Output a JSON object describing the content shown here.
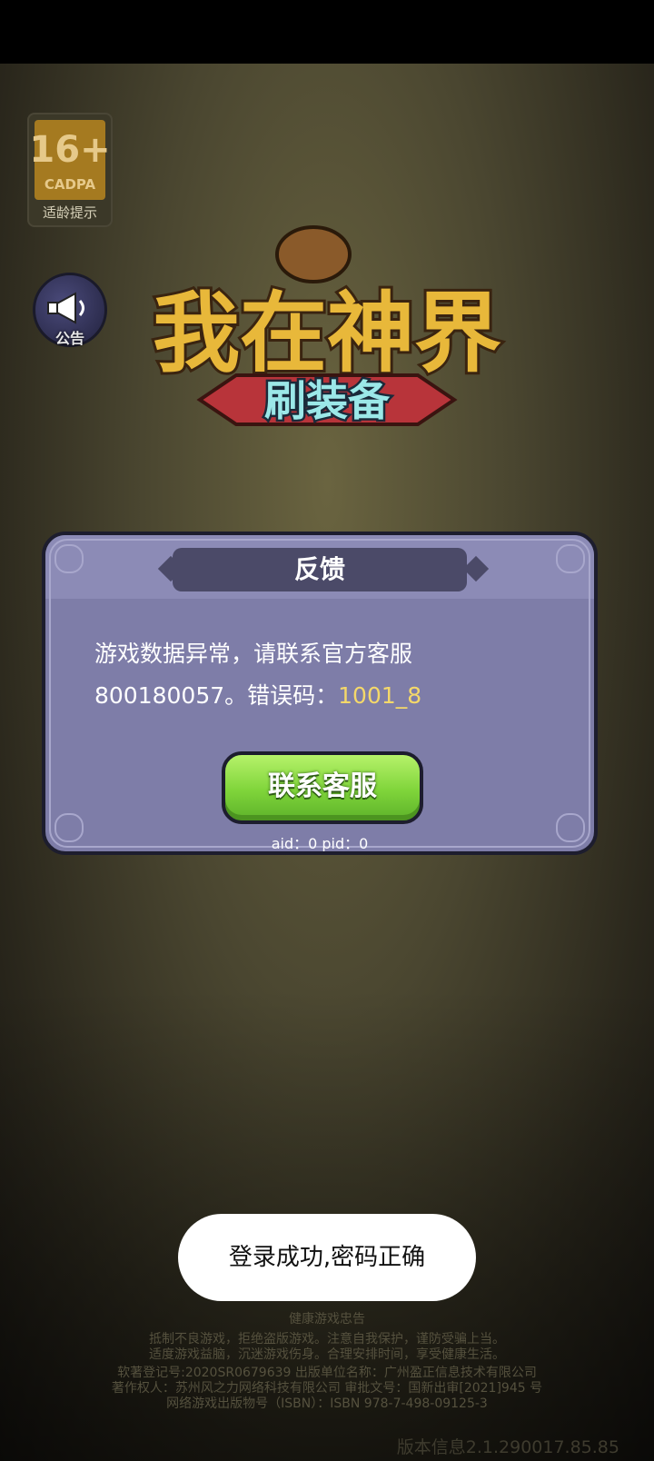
{
  "age_badge": {
    "age": "16+",
    "org": "CADPA",
    "label": "适龄提示"
  },
  "notice_button": {
    "label": "公告",
    "icon": "megaphone-icon"
  },
  "game_logo": {
    "title": "我在神界",
    "subtitle": "刷装备"
  },
  "dialog": {
    "title": "反馈",
    "message_line1": "游戏数据异常，请联系官方客服",
    "message_line2_prefix": "800180057。错误码：",
    "error_code": "1001_8",
    "button_label": "联系客服",
    "ids": "aid：0  pid：0"
  },
  "toast": {
    "text": "登录成功,密码正确"
  },
  "footer": {
    "heading": "健康游戏忠告",
    "lines": [
      "抵制不良游戏，拒绝盗版游戏。注意自我保护，谨防受骗上当。",
      "适度游戏益脑，沉迷游戏伤身。合理安排时间，享受健康生活。"
    ],
    "credits": [
      "软著登记号:2020SR0679639 出版单位名称：广州盈正信息技术有限公司",
      "著作权人：苏州风之力网络科技有限公司 审批文号：国新出审[2021]945 号",
      "网络游戏出版物号（ISBN）：ISBN 978-7-498-09125-3"
    ]
  },
  "version": "版本信息2.1.290017.85.85",
  "colors": {
    "error_code": "#f4d86a",
    "button_green": "#7fd43a",
    "dialog_bg": "#7e7da8"
  }
}
